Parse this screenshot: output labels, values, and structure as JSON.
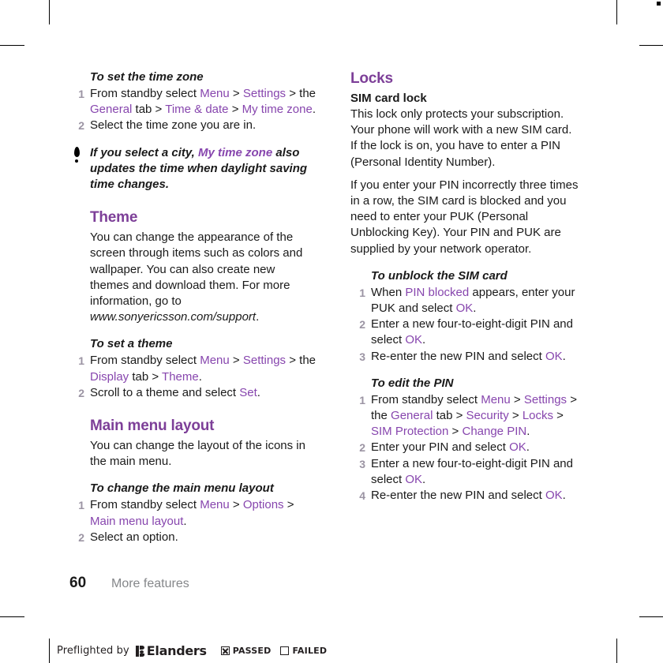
{
  "document": {
    "page_number": "60",
    "running_title": "More features"
  },
  "left_column": {
    "proc_time_zone": {
      "heading": "To set the time zone",
      "steps": [
        {
          "parts": [
            {
              "t": "From standby select ",
              "c": "plain"
            },
            {
              "t": "Menu",
              "c": "ui"
            },
            {
              "t": " > ",
              "c": "plain"
            },
            {
              "t": "Settings",
              "c": "ui"
            },
            {
              "t": " > the ",
              "c": "plain"
            },
            {
              "t": "General",
              "c": "ui"
            },
            {
              "t": " tab > ",
              "c": "plain"
            },
            {
              "t": "Time & date",
              "c": "ui"
            },
            {
              "t": " > ",
              "c": "plain"
            },
            {
              "t": "My time zone",
              "c": "ui"
            },
            {
              "t": ".",
              "c": "plain"
            }
          ]
        },
        {
          "parts": [
            {
              "t": "Select the time zone you are in.",
              "c": "plain"
            }
          ]
        }
      ]
    },
    "tip": {
      "icon": "exclamation-tip-icon",
      "parts": [
        {
          "t": "If you select a city, ",
          "c": "plain"
        },
        {
          "t": "My time zone",
          "c": "ui"
        },
        {
          "t": " also updates the time when daylight saving time changes.",
          "c": "plain"
        }
      ]
    },
    "theme_section": {
      "heading": "Theme",
      "body": "You can change the appearance of the screen through items such as colors and wallpaper. You can also create new themes and download them. For more information, go to ",
      "url": "www.sonyericsson.com/support",
      "body_end": "."
    },
    "proc_set_theme": {
      "heading": "To set a theme",
      "steps": [
        {
          "parts": [
            {
              "t": "From standby select ",
              "c": "plain"
            },
            {
              "t": "Menu",
              "c": "ui"
            },
            {
              "t": " > ",
              "c": "plain"
            },
            {
              "t": "Settings",
              "c": "ui"
            },
            {
              "t": " > the ",
              "c": "plain"
            },
            {
              "t": "Display",
              "c": "ui"
            },
            {
              "t": " tab > ",
              "c": "plain"
            },
            {
              "t": "Theme",
              "c": "ui"
            },
            {
              "t": ".",
              "c": "plain"
            }
          ]
        },
        {
          "parts": [
            {
              "t": "Scroll to a theme and select ",
              "c": "plain"
            },
            {
              "t": "Set",
              "c": "ui"
            },
            {
              "t": ".",
              "c": "plain"
            }
          ]
        }
      ]
    },
    "main_menu_section": {
      "heading": "Main menu layout",
      "body": "You can change the layout of the icons in the main menu."
    },
    "proc_change_layout": {
      "heading": "To change the main menu layout",
      "steps": [
        {
          "parts": [
            {
              "t": "From standby select ",
              "c": "plain"
            },
            {
              "t": "Menu",
              "c": "ui"
            },
            {
              "t": " > ",
              "c": "plain"
            },
            {
              "t": "Options",
              "c": "ui"
            },
            {
              "t": " > ",
              "c": "plain"
            },
            {
              "t": "Main menu layout",
              "c": "ui"
            },
            {
              "t": ".",
              "c": "plain"
            }
          ]
        },
        {
          "parts": [
            {
              "t": "Select an option.",
              "c": "plain"
            }
          ]
        }
      ]
    }
  },
  "right_column": {
    "locks_section": {
      "heading": "Locks",
      "subheading": "SIM card lock",
      "paragraph_1": "This lock only protects your subscription. Your phone will work with a new SIM card. If the lock is on, you have to enter a PIN (Personal Identity Number).",
      "paragraph_2": "If you enter your PIN incorrectly three times in a row, the SIM card is blocked and you need to enter your PUK (Personal Unblocking Key). Your PIN and PUK are supplied by your network operator."
    },
    "proc_unblock_sim": {
      "heading": "To unblock the SIM card",
      "steps": [
        {
          "parts": [
            {
              "t": "When ",
              "c": "plain"
            },
            {
              "t": "PIN blocked",
              "c": "ui"
            },
            {
              "t": " appears, enter your PUK and select ",
              "c": "plain"
            },
            {
              "t": "OK",
              "c": "ui"
            },
            {
              "t": ".",
              "c": "plain"
            }
          ]
        },
        {
          "parts": [
            {
              "t": "Enter a new four-to-eight-digit PIN and select ",
              "c": "plain"
            },
            {
              "t": "OK",
              "c": "ui"
            },
            {
              "t": ".",
              "c": "plain"
            }
          ]
        },
        {
          "parts": [
            {
              "t": "Re-enter the new PIN and select ",
              "c": "plain"
            },
            {
              "t": "OK",
              "c": "ui"
            },
            {
              "t": ".",
              "c": "plain"
            }
          ]
        }
      ]
    },
    "proc_edit_pin": {
      "heading": "To edit the PIN",
      "steps": [
        {
          "parts": [
            {
              "t": "From standby select ",
              "c": "plain"
            },
            {
              "t": "Menu",
              "c": "ui"
            },
            {
              "t": " > ",
              "c": "plain"
            },
            {
              "t": "Settings",
              "c": "ui"
            },
            {
              "t": " > the ",
              "c": "plain"
            },
            {
              "t": "General",
              "c": "ui"
            },
            {
              "t": " tab > ",
              "c": "plain"
            },
            {
              "t": "Security",
              "c": "ui"
            },
            {
              "t": " > ",
              "c": "plain"
            },
            {
              "t": "Locks",
              "c": "ui"
            },
            {
              "t": " > ",
              "c": "plain"
            },
            {
              "t": "SIM Protection",
              "c": "ui"
            },
            {
              "t": " > ",
              "c": "plain"
            },
            {
              "t": "Change PIN",
              "c": "ui"
            },
            {
              "t": ".",
              "c": "plain"
            }
          ]
        },
        {
          "parts": [
            {
              "t": "Enter your PIN and select ",
              "c": "plain"
            },
            {
              "t": "OK",
              "c": "ui"
            },
            {
              "t": ".",
              "c": "plain"
            }
          ]
        },
        {
          "parts": [
            {
              "t": "Enter a new four-to-eight-digit PIN and select ",
              "c": "plain"
            },
            {
              "t": "OK",
              "c": "ui"
            },
            {
              "t": ".",
              "c": "plain"
            }
          ]
        },
        {
          "parts": [
            {
              "t": "Re-enter the new PIN and select ",
              "c": "plain"
            },
            {
              "t": "OK",
              "c": "ui"
            },
            {
              "t": ".",
              "c": "plain"
            }
          ]
        }
      ]
    }
  },
  "preflight_bar": {
    "label": "Preflighted by",
    "brand": "Elanders",
    "passed_label": "PASSED",
    "passed_checked": true,
    "failed_label": "FAILED",
    "failed_checked": false
  },
  "colors": {
    "accent_purple": "#7D3F98",
    "ui_term_purple": "#8746AE",
    "body_text": "#1a1a1a",
    "step_number": "#9b94a3",
    "running_title": "#85878a"
  }
}
